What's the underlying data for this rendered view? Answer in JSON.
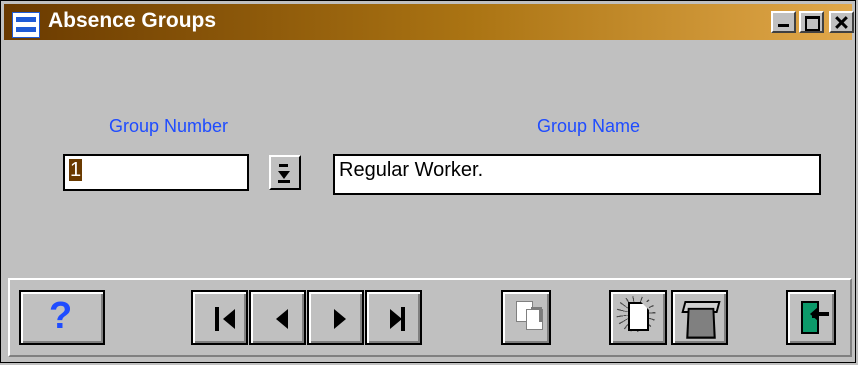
{
  "window": {
    "title": "Absence Groups",
    "controls": [
      "minimize",
      "maximize",
      "close"
    ]
  },
  "form": {
    "group_number_label": "Group Number",
    "group_number_value": "1",
    "group_name_label": "Group Name",
    "group_name_value": "Regular Worker."
  },
  "toolbar": {
    "buttons": [
      "help",
      "first-record",
      "previous-record",
      "next-record",
      "last-record",
      "copy",
      "new-record",
      "delete-record",
      "exit"
    ]
  }
}
